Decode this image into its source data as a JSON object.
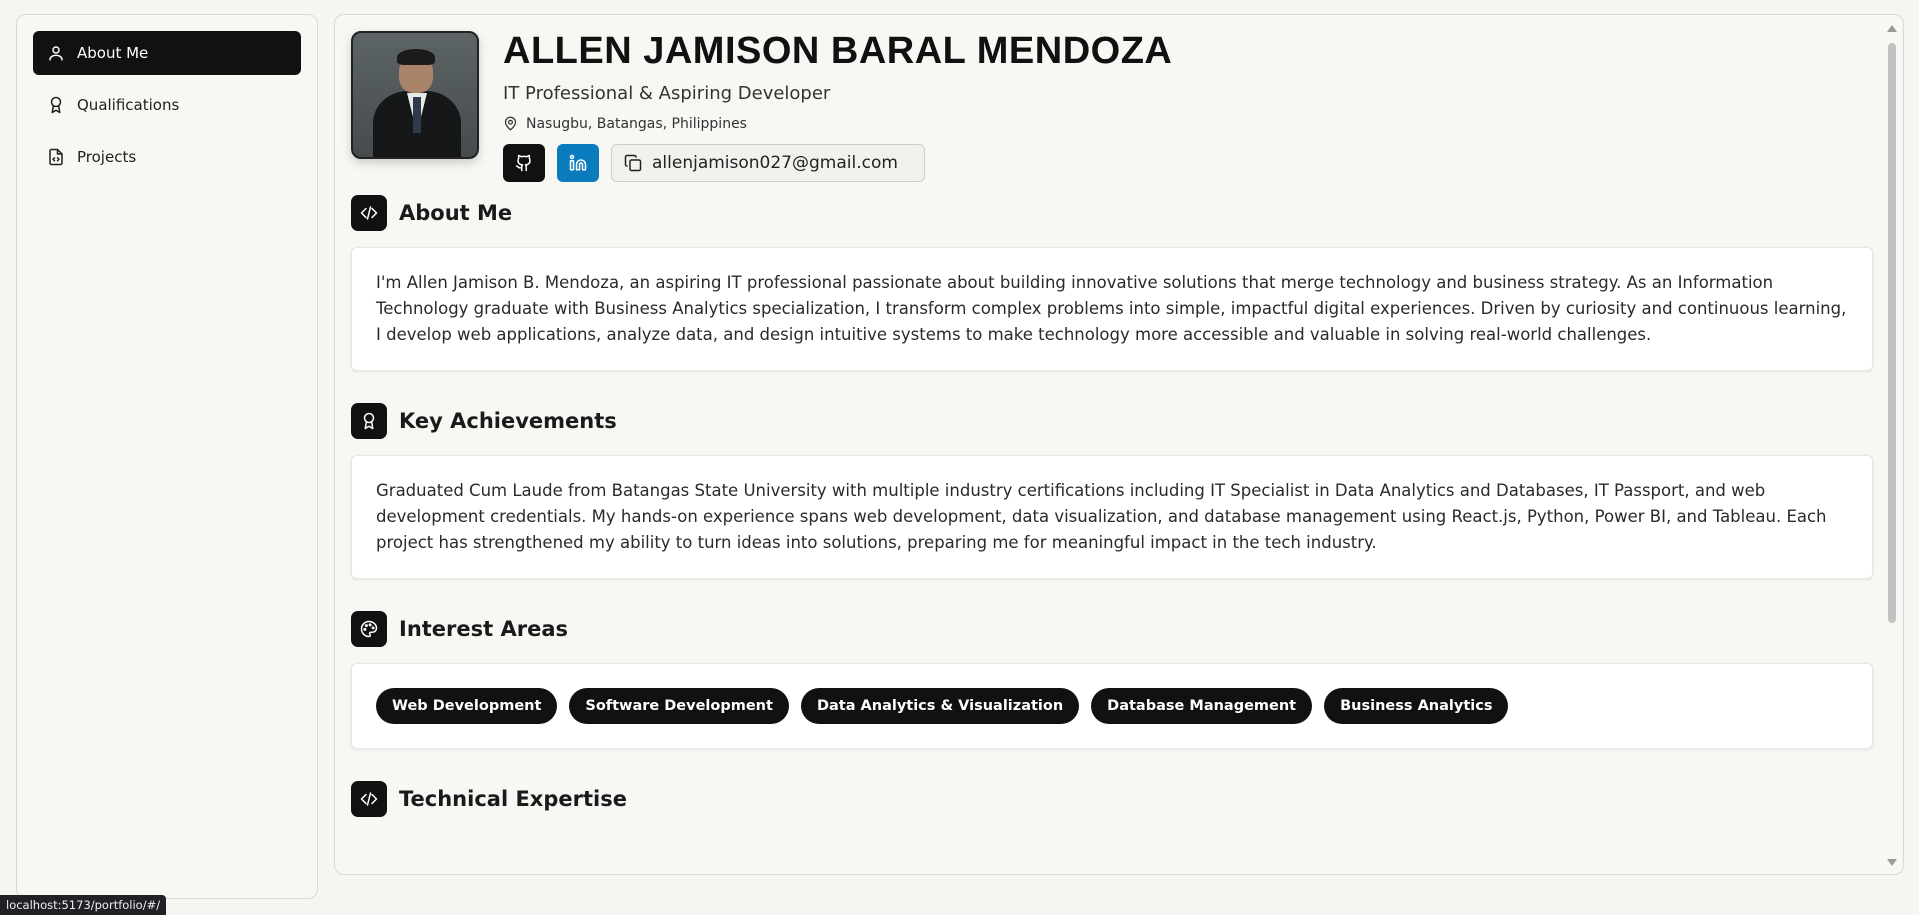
{
  "sidebar": {
    "items": [
      {
        "label": "About Me",
        "icon": "user-icon",
        "active": true
      },
      {
        "label": "Qualifications",
        "icon": "award-icon",
        "active": false
      },
      {
        "label": "Projects",
        "icon": "file-code-icon",
        "active": false
      }
    ]
  },
  "profile": {
    "name": "ALLEN JAMISON BARAL MENDOZA",
    "role": "IT Professional & Aspiring Developer",
    "location": "Nasugbu, Batangas, Philippines",
    "email": "allenjamison027@gmail.com"
  },
  "sections": {
    "about": {
      "title": "About Me",
      "text": "I'm Allen Jamison B. Mendoza, an aspiring IT professional passionate about building innovative solutions that merge technology and business strategy. As an Information Technology graduate with Business Analytics specialization, I transform complex problems into simple, impactful digital experiences. Driven by curiosity and continuous learning, I develop web applications, analyze data, and design intuitive systems to make technology more accessible and valuable in solving real-world challenges."
    },
    "achievements": {
      "title": "Key Achievements",
      "text": "Graduated Cum Laude from Batangas State University with multiple industry certifications including IT Specialist in Data Analytics and Databases, IT Passport, and web development credentials. My hands-on experience spans web development, data visualization, and database management using React.js, Python, Power BI, and Tableau. Each project has strengthened my ability to turn ideas into solutions, preparing me for meaningful impact in the tech industry."
    },
    "interests": {
      "title": "Interest Areas",
      "tags": [
        "Web Development",
        "Software Development",
        "Data Analytics & Visualization",
        "Database Management",
        "Business Analytics"
      ]
    },
    "technical": {
      "title": "Technical Expertise"
    }
  },
  "status_bar": {
    "url": "localhost:5173/portfolio/#/"
  },
  "colors": {
    "background": "#f5f5f1",
    "dark": "#111111",
    "linkedin": "#0a7bbd",
    "card": "#ffffff"
  }
}
